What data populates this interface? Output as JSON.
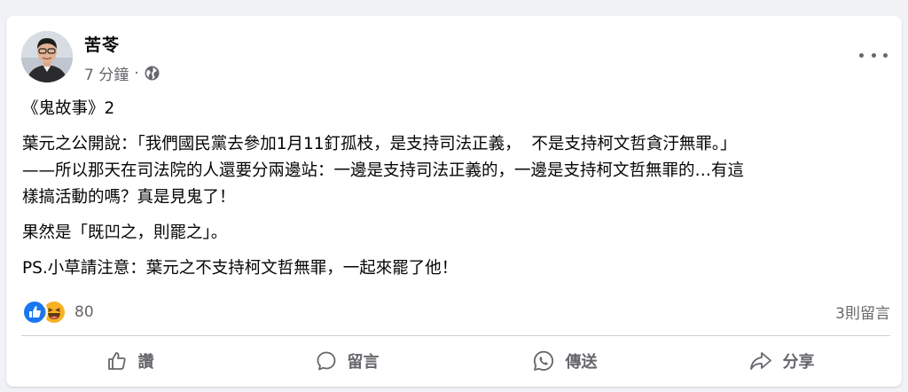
{
  "post": {
    "author": "苦苓",
    "time": "7 分鐘",
    "time_separator": "·",
    "visibility_icon": "globe-icon",
    "more_icon": "more-dots-icon",
    "lines": [
      "《鬼故事》2",
      "葉元之公開說：「我們國民黨去參加1月11釘孤枝，是支持司法正義，  不是支持柯文哲貪汙無罪。」",
      "——所以那天在司法院的人還要分兩邊站：一邊是支持司法正義的，一邊是支持柯文哲無罪的…有這",
      "樣搞活動的嗎？真是見鬼了！",
      "果然是「既凹之，則罷之」。",
      "PS.小草請注意：葉元之不支持柯文哲無罪，一起來罷了他！"
    ]
  },
  "footer": {
    "reaction_icons": [
      "like-reaction-icon",
      "haha-reaction-icon"
    ],
    "reaction_count": "80",
    "comment_count": "3則留言"
  },
  "actions": {
    "like": "讚",
    "comment": "留言",
    "share_whatsapp": "傳送",
    "share": "分享"
  },
  "colors": {
    "background": "#f0f2f5",
    "card": "#ffffff",
    "secondary_text": "#65676b",
    "like_blue": "#1877f2",
    "haha_yellow": "#f7b125"
  }
}
